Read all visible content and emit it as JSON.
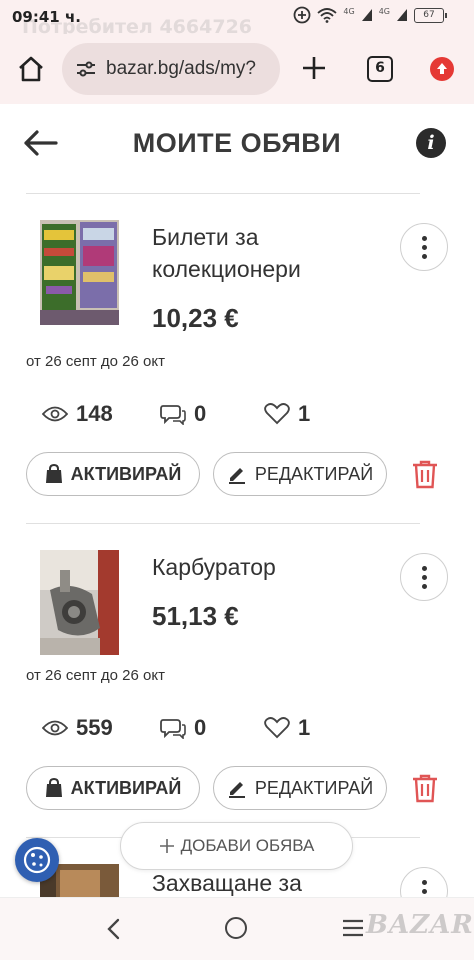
{
  "status_bar": {
    "time": "09:41 ч.",
    "ghost_text": "Потребител 4664726",
    "network": "4G",
    "battery": "67"
  },
  "browser": {
    "url": "bazar.bg/ads/my?",
    "tabs_count": "6"
  },
  "header": {
    "title": "МОИТЕ ОБЯВИ",
    "info_label": "i"
  },
  "ads": [
    {
      "title": "Билети за колекционери",
      "price": "10,23 €",
      "period": "от 26 септ до 26 окт",
      "views": "148",
      "messages": "0",
      "favorites": "1"
    },
    {
      "title": "Карбуратор",
      "price": "51,13 €",
      "period": "от 26 септ до 26 окт",
      "views": "559",
      "messages": "0",
      "favorites": "1"
    },
    {
      "title": "Захващане за"
    }
  ],
  "actions": {
    "activate_label": "АКТИВИРАЙ",
    "edit_label": "РЕДАКТИРАЙ"
  },
  "add_button": {
    "label": "ДОБАВИ ОБЯВА"
  },
  "watermark": "BAZAR",
  "colors": {
    "accent_red": "#e05555",
    "status_bg": "#fbf0f0",
    "cookie_blue": "#2f5fb2"
  }
}
